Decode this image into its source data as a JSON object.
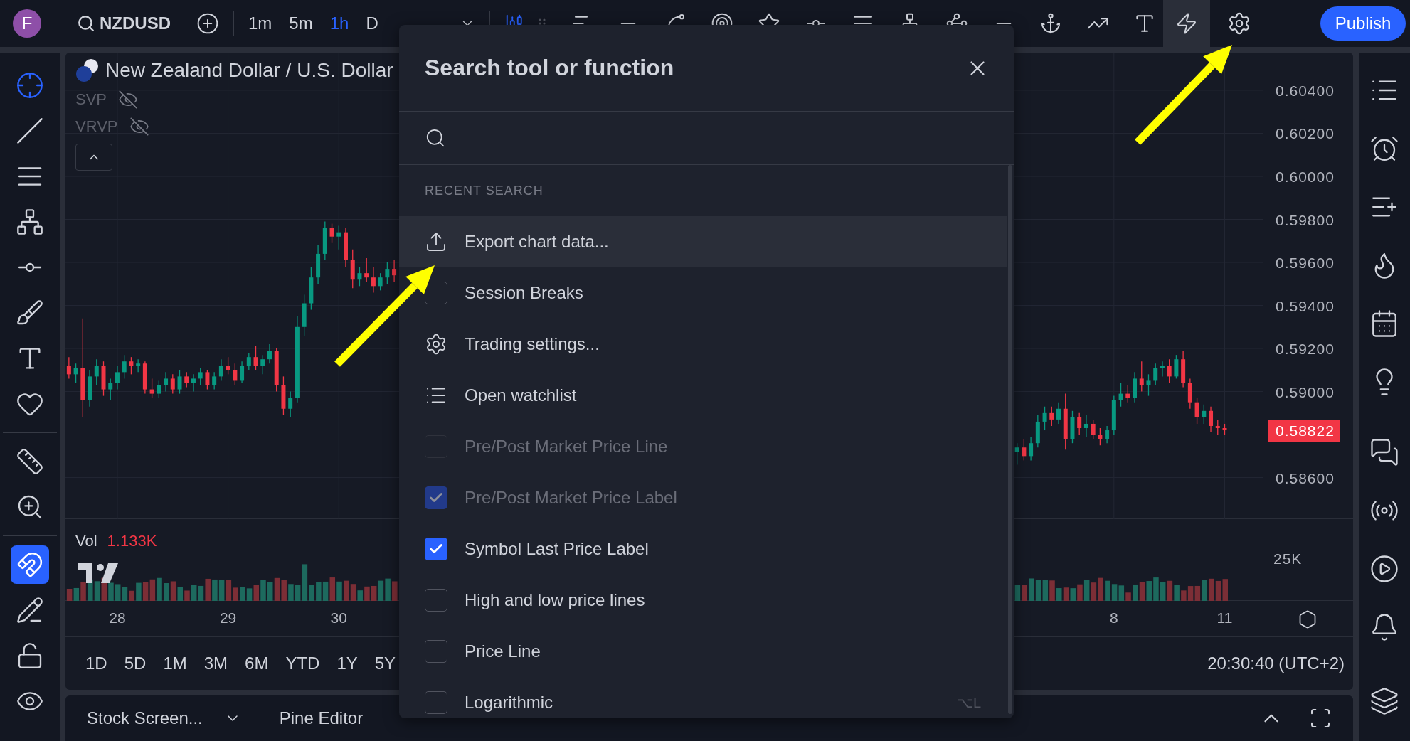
{
  "topbar": {
    "avatar": "F",
    "symbol": "NZDUSD",
    "intervals": [
      {
        "label": "1m",
        "selected": false
      },
      {
        "label": "5m",
        "selected": false
      },
      {
        "label": "1h",
        "selected": true
      },
      {
        "label": "D",
        "selected": false
      }
    ],
    "publish": "Publish"
  },
  "chart": {
    "title": "New Zealand Dollar / U.S. Dollar",
    "indicators": [
      "SVP",
      "VRVP"
    ],
    "chart_data": {
      "type": "candlestick",
      "grid": true,
      "ylim": [
        0.58407,
        0.60575
      ],
      "categories": [
        null,
        null,
        null,
        null,
        null,
        null,
        null,
        null,
        null,
        null,
        null,
        null,
        null,
        null,
        null,
        null,
        null,
        null,
        null,
        null,
        null,
        null,
        null,
        null,
        null,
        null,
        null,
        null,
        null,
        null,
        null,
        null,
        null,
        null,
        null,
        null,
        null,
        null,
        null,
        null,
        null,
        null,
        null,
        null,
        null,
        null,
        null,
        null,
        null,
        null,
        null,
        null,
        null,
        null,
        null,
        null,
        null,
        null,
        null,
        null,
        null,
        null,
        null,
        null,
        null,
        null,
        null,
        null,
        null,
        null,
        null,
        null,
        null,
        null,
        null,
        null,
        null,
        null,
        null,
        null,
        null,
        null,
        null,
        null,
        null,
        null,
        null,
        null,
        null,
        null,
        null,
        null,
        null,
        null,
        null,
        null,
        null,
        null,
        null,
        null,
        null,
        null,
        null,
        null,
        null,
        null,
        null,
        null,
        null,
        null,
        null,
        null,
        null,
        null,
        null,
        null,
        null,
        null,
        null,
        null,
        null,
        null,
        null,
        null,
        null,
        null,
        null,
        null,
        null,
        null,
        null,
        null,
        null,
        null,
        null,
        null,
        null,
        null,
        null,
        null,
        null,
        null,
        null,
        null,
        null,
        null,
        null,
        null,
        null,
        null,
        null,
        null,
        null,
        null,
        null,
        null,
        null,
        null,
        null,
        null,
        null,
        null,
        null,
        null,
        null,
        null,
        null,
        null,
        null,
        null,
        null,
        null,
        null
      ],
      "ohlc": [
        [
          0.5912,
          0.5916,
          0.5906,
          0.5908
        ],
        [
          0.5908,
          0.5913,
          0.5904,
          0.5911
        ],
        [
          0.5911,
          0.5934,
          0.5888,
          0.5896
        ],
        [
          0.5896,
          0.591,
          0.5893,
          0.5907
        ],
        [
          0.5907,
          0.5915,
          0.5903,
          0.5912
        ],
        [
          0.5912,
          0.5914,
          0.5898,
          0.5901
        ],
        [
          0.5901,
          0.5906,
          0.5896,
          0.5904
        ],
        [
          0.5904,
          0.5912,
          0.5901,
          0.5909
        ],
        [
          0.5909,
          0.5917,
          0.5906,
          0.5914
        ],
        [
          0.5914,
          0.5916,
          0.5908,
          0.5912
        ],
        [
          0.5912,
          0.5915,
          0.5909,
          0.5913
        ],
        [
          0.5913,
          0.5914,
          0.5899,
          0.5901
        ],
        [
          0.5901,
          0.5906,
          0.5897,
          0.5899
        ],
        [
          0.5899,
          0.5905,
          0.5897,
          0.5903
        ],
        [
          0.5903,
          0.5909,
          0.59,
          0.5906
        ],
        [
          0.5906,
          0.5908,
          0.5899,
          0.5901
        ],
        [
          0.5901,
          0.591,
          0.5899,
          0.5907
        ],
        [
          0.5907,
          0.5909,
          0.5902,
          0.5904
        ],
        [
          0.5904,
          0.5908,
          0.59,
          0.5906
        ],
        [
          0.5906,
          0.5911,
          0.5903,
          0.5909
        ],
        [
          0.5909,
          0.591,
          0.5901,
          0.5903
        ],
        [
          0.5903,
          0.5909,
          0.5901,
          0.5907
        ],
        [
          0.5907,
          0.5915,
          0.5905,
          0.5912
        ],
        [
          0.5912,
          0.5916,
          0.5908,
          0.591
        ],
        [
          0.591,
          0.5913,
          0.5903,
          0.5905
        ],
        [
          0.5905,
          0.5914,
          0.5904,
          0.5912
        ],
        [
          0.5912,
          0.5918,
          0.591,
          0.5916
        ],
        [
          0.5916,
          0.5921,
          0.591,
          0.5912
        ],
        [
          0.5912,
          0.5917,
          0.5908,
          0.5915
        ],
        [
          0.5915,
          0.5922,
          0.5913,
          0.5919
        ],
        [
          0.5919,
          0.592,
          0.59,
          0.5903
        ],
        [
          0.5903,
          0.5907,
          0.5889,
          0.5892
        ],
        [
          0.5892,
          0.59,
          0.5888,
          0.5897
        ],
        [
          0.5897,
          0.5935,
          0.5895,
          0.593
        ],
        [
          0.593,
          0.5945,
          0.5926,
          0.5941
        ],
        [
          0.5941,
          0.5958,
          0.5938,
          0.5953
        ],
        [
          0.5953,
          0.5968,
          0.595,
          0.5964
        ],
        [
          0.5964,
          0.5979,
          0.5961,
          0.5976
        ],
        [
          0.5976,
          0.5978,
          0.5969,
          0.5972
        ],
        [
          0.5972,
          0.5977,
          0.5966,
          0.5974
        ],
        [
          0.5974,
          0.5976,
          0.5958,
          0.5961
        ],
        [
          0.5961,
          0.5966,
          0.5948,
          0.5952
        ],
        [
          0.5952,
          0.5958,
          0.5949,
          0.5955
        ],
        [
          0.5955,
          0.5962,
          0.5951,
          0.5953
        ],
        [
          0.5953,
          0.5958,
          0.5946,
          0.5949
        ],
        [
          0.5949,
          0.5955,
          0.5947,
          0.5953
        ],
        [
          0.5953,
          0.596,
          0.595,
          0.5957
        ],
        [
          0.5957,
          0.5961,
          0.5951,
          0.5954
        ],
        null,
        null,
        null,
        null,
        null,
        null,
        null,
        null,
        null,
        null,
        null,
        null,
        null,
        null,
        null,
        null,
        null,
        null,
        null,
        null,
        null,
        null,
        null,
        null,
        null,
        null,
        null,
        null,
        null,
        null,
        null,
        null,
        null,
        null,
        null,
        null,
        null,
        null,
        null,
        null,
        null,
        null,
        null,
        null,
        null,
        null,
        null,
        null,
        null,
        null,
        null,
        null,
        null,
        null,
        null,
        null,
        null,
        null,
        null,
        null,
        null,
        null,
        null,
        null,
        null,
        null,
        null,
        null,
        null,
        null,
        null,
        null,
        null,
        null,
        null,
        null,
        null,
        null,
        null,
        null,
        null,
        null,
        null,
        null,
        null,
        null,
        null,
        null,
        null,
        [
          0.5872,
          0.5876,
          0.5866,
          0.5874
        ],
        [
          0.5874,
          0.5878,
          0.5868,
          0.587
        ],
        [
          0.587,
          0.5879,
          0.5868,
          0.5876
        ],
        [
          0.5876,
          0.5889,
          0.5874,
          0.5886
        ],
        [
          0.5886,
          0.5893,
          0.5882,
          0.589
        ],
        [
          0.589,
          0.5893,
          0.5884,
          0.5887
        ],
        [
          0.5887,
          0.5895,
          0.5885,
          0.5892
        ],
        [
          0.5892,
          0.5899,
          0.5873,
          0.5878
        ],
        [
          0.5878,
          0.5891,
          0.5876,
          0.5888
        ],
        [
          0.5888,
          0.589,
          0.588,
          0.5883
        ],
        [
          0.5883,
          0.5889,
          0.5879,
          0.5885
        ],
        [
          0.5885,
          0.5887,
          0.5878,
          0.588
        ],
        [
          0.588,
          0.5883,
          0.5875,
          0.5878
        ],
        [
          0.5878,
          0.5884,
          0.5876,
          0.5882
        ],
        [
          0.5882,
          0.5898,
          0.588,
          0.5896
        ],
        [
          0.5896,
          0.5904,
          0.5893,
          0.5899
        ],
        [
          0.5899,
          0.5903,
          0.5895,
          0.5897
        ],
        [
          0.5897,
          0.5909,
          0.5895,
          0.5906
        ],
        [
          0.5906,
          0.5914,
          0.59,
          0.5903
        ],
        [
          0.5903,
          0.5908,
          0.5898,
          0.5905
        ],
        [
          0.5905,
          0.5913,
          0.5903,
          0.5911
        ],
        [
          0.5911,
          0.5914,
          0.5907,
          0.5912
        ],
        [
          0.5912,
          0.5915,
          0.5904,
          0.5907
        ],
        [
          0.5907,
          0.5917,
          0.5906,
          0.5915
        ],
        [
          0.5915,
          0.5919,
          0.5902,
          0.5904
        ],
        [
          0.5904,
          0.5906,
          0.5892,
          0.5895
        ],
        [
          0.5895,
          0.5897,
          0.5885,
          0.5888
        ],
        [
          0.5888,
          0.5894,
          0.5885,
          0.5891
        ],
        [
          0.5891,
          0.5893,
          0.5881,
          0.5884
        ],
        [
          0.5884,
          0.5887,
          0.588,
          0.5883
        ],
        [
          0.5883,
          0.5885,
          0.588,
          0.5882
        ],
        null,
        null,
        null,
        null,
        null
      ],
      "yticks": [
        {
          "value": 0.604,
          "label": "0.60400"
        },
        {
          "value": 0.602,
          "label": "0.60200"
        },
        {
          "value": 0.6,
          "label": "0.60000"
        },
        {
          "value": 0.598,
          "label": "0.59800"
        },
        {
          "value": 0.596,
          "label": "0.59600"
        },
        {
          "value": 0.594,
          "label": "0.59400"
        },
        {
          "value": 0.592,
          "label": "0.59200"
        },
        {
          "value": 0.59,
          "label": "0.59000"
        },
        {
          "value": 0.586,
          "label": "0.58600"
        }
      ]
    },
    "time_ticks": [
      "28",
      "29",
      "30",
      "8",
      "11"
    ],
    "last_price": "0.58822",
    "volume": {
      "label": "Vol",
      "value": "1.133K",
      "tick": "25K"
    },
    "ranges": [
      "1D",
      "5D",
      "1M",
      "3M",
      "6M",
      "YTD",
      "1Y",
      "5Y"
    ],
    "clock": "20:30:40 (UTC+2)"
  },
  "bottom_panel": {
    "tabs": [
      "Stock Screen...",
      "Pine Editor"
    ]
  },
  "dialog": {
    "title": "Search tool or function",
    "section": "RECENT SEARCH",
    "items": [
      {
        "kind": "export",
        "label": "Export chart data...",
        "selected": true
      },
      {
        "kind": "toggle",
        "label": "Session Breaks",
        "checked": false,
        "disabled": false,
        "selected": false
      },
      {
        "kind": "settings",
        "label": "Trading settings...",
        "selected": false
      },
      {
        "kind": "watchlist",
        "label": "Open watchlist",
        "selected": false
      },
      {
        "kind": "toggle",
        "label": "Pre/Post Market Price Line",
        "checked": false,
        "disabled": true,
        "selected": false
      },
      {
        "kind": "toggle",
        "label": "Pre/Post Market Price Label",
        "checked": true,
        "disabled": true,
        "selected": false
      },
      {
        "kind": "toggle",
        "label": "Symbol Last Price Label",
        "checked": true,
        "disabled": false,
        "selected": false
      },
      {
        "kind": "toggle",
        "label": "High and low price lines",
        "checked": false,
        "disabled": false,
        "selected": false
      },
      {
        "kind": "toggle",
        "label": "Price Line",
        "checked": false,
        "disabled": false,
        "selected": false
      },
      {
        "kind": "toggle",
        "label": "Logarithmic",
        "checked": false,
        "disabled": false,
        "selected": false,
        "shortcut": "⌥L"
      }
    ]
  }
}
